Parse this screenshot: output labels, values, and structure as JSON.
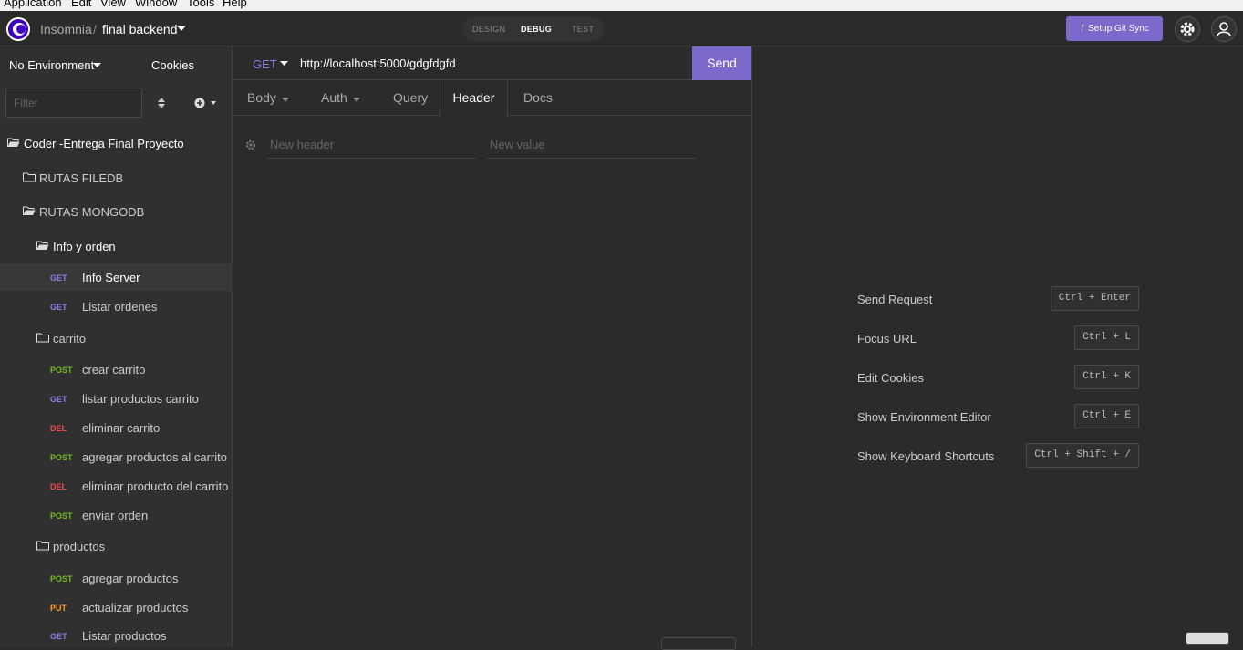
{
  "menubar": [
    "Application",
    "Edit",
    "View",
    "Window",
    "Tools",
    "Help"
  ],
  "header": {
    "brand": "Insomnia",
    "separator": "/",
    "workspace": "final backend",
    "modes": [
      "DESIGN",
      "DEBUG",
      "TEST"
    ],
    "active_mode": "DEBUG",
    "git_sync": "Setup Git Sync"
  },
  "sidebar": {
    "environment": "No Environment",
    "cookies": "Cookies",
    "filter_placeholder": "Filter",
    "items": [
      {
        "type": "folder",
        "label": "Coder -Entrega Final Proyecto",
        "open": true
      },
      {
        "type": "folder",
        "label": "RUTAS FILEDB",
        "open": false
      },
      {
        "type": "folder",
        "label": "RUTAS MONGODB",
        "open": true
      },
      {
        "type": "folder",
        "label": "Info y orden",
        "open": true
      },
      {
        "type": "request",
        "method": "GET",
        "label": "Info Server",
        "active": true
      },
      {
        "type": "request",
        "method": "GET",
        "label": "Listar ordenes"
      },
      {
        "type": "folder",
        "label": "carrito",
        "open": false
      },
      {
        "type": "request",
        "method": "POST",
        "label": "crear carrito"
      },
      {
        "type": "request",
        "method": "GET",
        "label": "listar productos carrito"
      },
      {
        "type": "request",
        "method": "DEL",
        "label": "eliminar carrito"
      },
      {
        "type": "request",
        "method": "POST",
        "label": "agregar productos al carrito"
      },
      {
        "type": "request",
        "method": "DEL",
        "label": "eliminar producto del carrito"
      },
      {
        "type": "request",
        "method": "POST",
        "label": "enviar orden"
      },
      {
        "type": "folder",
        "label": "productos",
        "open": false
      },
      {
        "type": "request",
        "method": "POST",
        "label": "agregar productos"
      },
      {
        "type": "request",
        "method": "PUT",
        "label": "actualizar productos"
      },
      {
        "type": "request",
        "method": "GET",
        "label": "Listar productos"
      }
    ]
  },
  "request": {
    "method": "GET",
    "url": "http://localhost:5000/gdgfdgfd",
    "send": "Send",
    "tabs": [
      "Body",
      "Auth",
      "Query",
      "Header",
      "Docs"
    ],
    "active_tab": "Header",
    "header_name_placeholder": "New header",
    "header_value_placeholder": "New value"
  },
  "shortcuts": [
    {
      "label": "Send Request",
      "keys": "Ctrl + Enter"
    },
    {
      "label": "Focus URL",
      "keys": "Ctrl + L"
    },
    {
      "label": "Edit Cookies",
      "keys": "Ctrl + K"
    },
    {
      "label": "Show Environment Editor",
      "keys": "Ctrl + E"
    },
    {
      "label": "Show Keyboard Shortcuts",
      "keys": "Ctrl + Shift + /"
    }
  ],
  "colors": {
    "accent": "#7d69cb",
    "get": "#8a7ee9",
    "post": "#75ba24",
    "del": "#ec4d4d",
    "put": "#ff9a1f"
  }
}
